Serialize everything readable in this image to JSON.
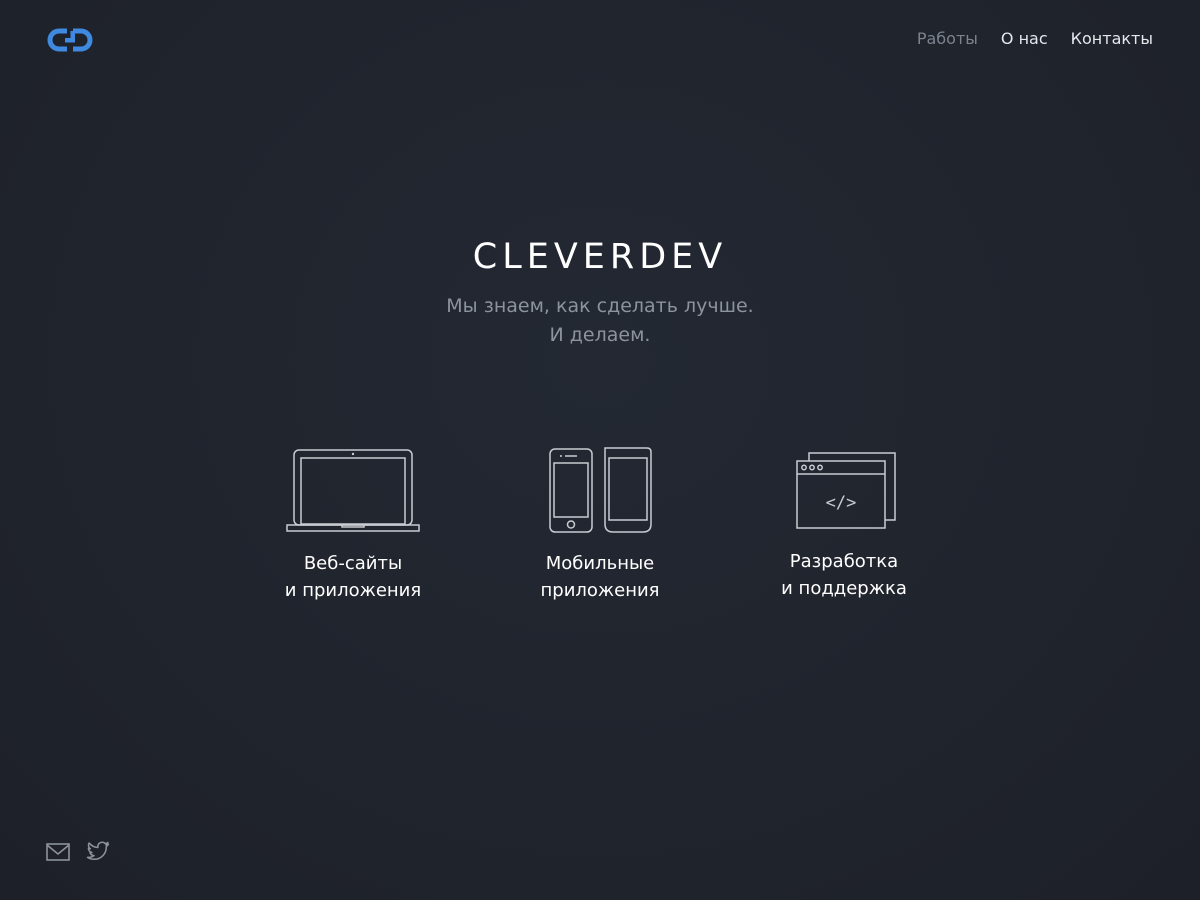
{
  "header": {
    "logo_icon": "cleverdev-logo-icon",
    "nav": [
      {
        "label": "Работы",
        "state": "inactive"
      },
      {
        "label": "О нас",
        "state": "active"
      },
      {
        "label": "Контакты",
        "state": "active"
      }
    ]
  },
  "hero": {
    "brand": "CLEVERDEV",
    "tagline_line1": "Мы знаем, как сделать лучше.",
    "tagline_line2": "И делаем."
  },
  "services": [
    {
      "icon": "laptop-icon",
      "line1": "Веб-сайты",
      "line2": "и приложения"
    },
    {
      "icon": "mobile-devices-icon",
      "line1": "Мобильные",
      "line2": "приложения"
    },
    {
      "icon": "code-window-icon",
      "line1": "Разработка",
      "line2": "и поддержка"
    }
  ],
  "footer": {
    "icons": [
      "mail-icon",
      "twitter-icon"
    ]
  },
  "colors": {
    "background": "#21252e",
    "accent": "#3f8ae0",
    "nav_muted": "#7c838f",
    "text": "#ffffff",
    "tagline": "#8d939d",
    "icon_stroke": "#c9ccd2"
  }
}
